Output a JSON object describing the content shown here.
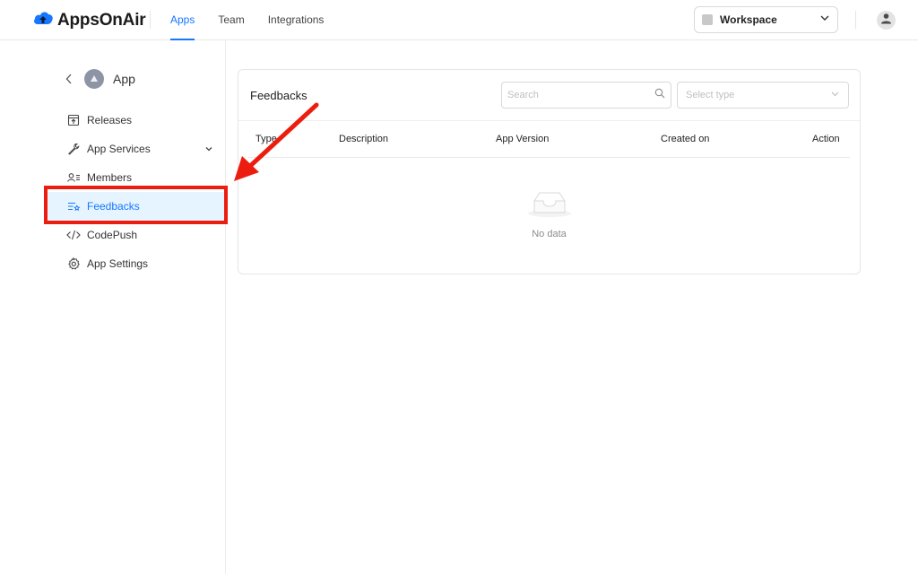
{
  "header": {
    "brand": "AppsOnAir",
    "nav": [
      {
        "label": "Apps",
        "active": true
      },
      {
        "label": "Team",
        "active": false
      },
      {
        "label": "Integrations",
        "active": false
      }
    ],
    "workspace_label": "Workspace"
  },
  "sidebar": {
    "app_name": "App",
    "items": [
      {
        "label": "Releases",
        "icon": "release-icon"
      },
      {
        "label": "App Services",
        "icon": "wrench-icon",
        "expandable": true
      },
      {
        "label": "Members",
        "icon": "members-icon"
      },
      {
        "label": "Feedbacks",
        "icon": "feedback-icon",
        "active": true
      },
      {
        "label": "CodePush",
        "icon": "code-icon"
      },
      {
        "label": "App Settings",
        "icon": "gear-icon"
      }
    ]
  },
  "main": {
    "title": "Feedbacks",
    "search_placeholder": "Search",
    "select_placeholder": "Select type",
    "columns": [
      "Type",
      "Description",
      "App Version",
      "Created on",
      "Action"
    ],
    "empty_text": "No data"
  },
  "colors": {
    "accent": "#1677ff",
    "annotation": "#ec1d0e"
  }
}
